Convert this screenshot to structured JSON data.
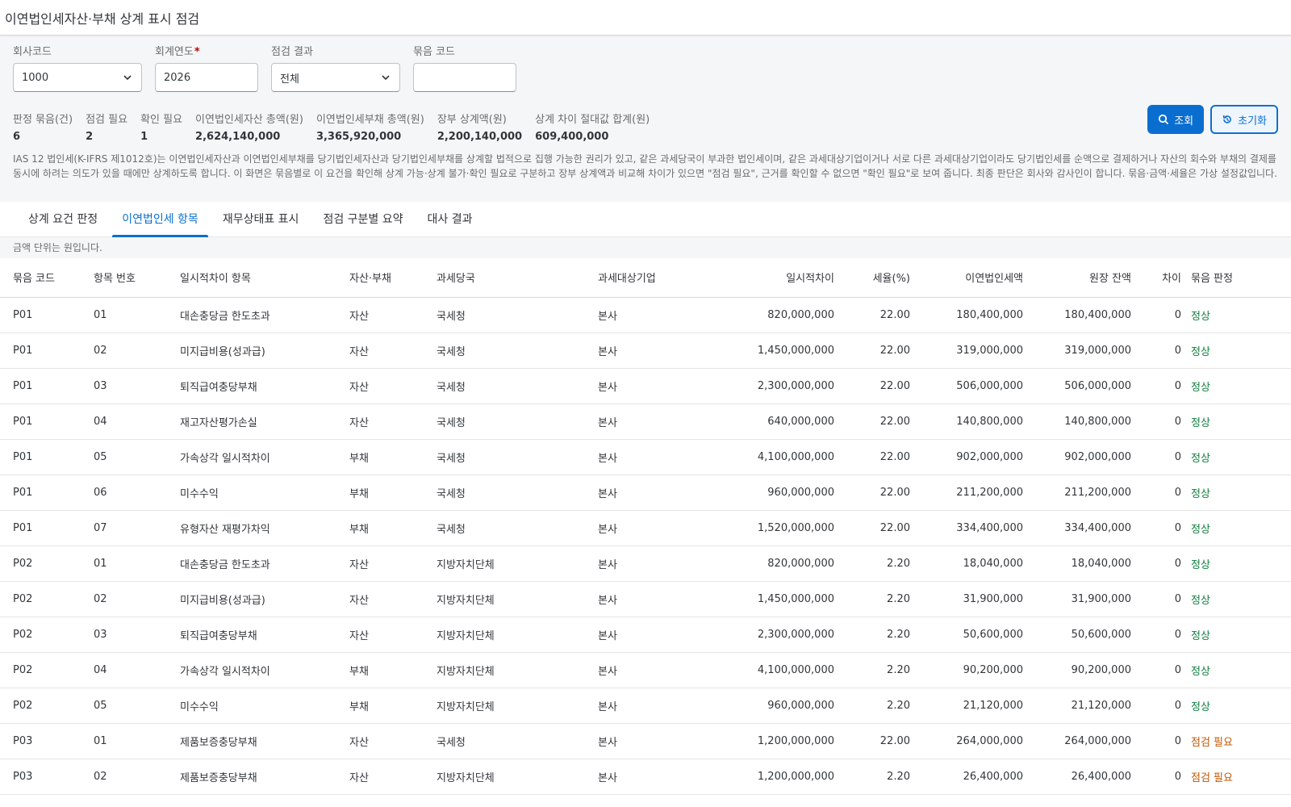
{
  "page": {
    "title": "이연법인세자산·부채 상계 표시 점검"
  },
  "filters": {
    "company": {
      "label": "회사코드",
      "value": "1000"
    },
    "year": {
      "label": "회계연도",
      "required_mark": "*",
      "value": "2026"
    },
    "result": {
      "label": "점검 결과",
      "value": "전체"
    },
    "group": {
      "label": "묶음 코드",
      "value": ""
    }
  },
  "actions": {
    "search_label": "조회",
    "reset_label": "초기화"
  },
  "kpis": [
    {
      "label": "판정 묶음(건)",
      "value": "6"
    },
    {
      "label": "점검 필요",
      "value": "2"
    },
    {
      "label": "확인 필요",
      "value": "1"
    },
    {
      "label": "이연법인세자산 총액(원)",
      "value": "2,624,140,000"
    },
    {
      "label": "이연법인세부채 총액(원)",
      "value": "3,365,920,000"
    },
    {
      "label": "장부 상계액(원)",
      "value": "2,200,140,000"
    },
    {
      "label": "상계 차이 절대값 합계(원)",
      "value": "609,400,000"
    }
  ],
  "note": "IAS 12 법인세(K-IFRS 제1012호)는 이연법인세자산과 이연법인세부채를 당기법인세자산과 당기법인세부채를 상계할 법적으로 집행 가능한 권리가 있고, 같은 과세당국이 부과한 법인세이며, 같은 과세대상기업이거나 서로 다른 과세대상기업이라도 당기법인세를 순액으로 결제하거나 자산의 회수와 부채의 결제를 동시에 하려는 의도가 있을 때에만 상계하도록 합니다. 이 화면은 묶음별로 이 요건을 확인해 상계 가능·상계 불가·확인 필요로 구분하고 장부 상계액과 비교해 차이가 있으면 \"점검 필요\", 근거를 확인할 수 없으면 \"확인 필요\"로 보여 줍니다. 최종 판단은 회사와 감사인이 합니다. 묶음·금액·세율은 가상 설정값입니다.",
  "tabs": [
    {
      "label": "상계 요건 판정",
      "active": false
    },
    {
      "label": "이연법인세 항목",
      "active": true
    },
    {
      "label": "재무상태표 표시",
      "active": false
    },
    {
      "label": "점검 구분별 요약",
      "active": false
    },
    {
      "label": "대사 결과",
      "active": false
    }
  ],
  "unit_note": "금액 단위는 원입니다.",
  "table": {
    "columns": [
      "묶음 코드",
      "항목 번호",
      "일시적차이 항목",
      "자산·부채",
      "과세당국",
      "과세대상기업",
      "일시적차이",
      "세율(%)",
      "이연법인세액",
      "원장 잔액",
      "차이",
      "묶음 판정"
    ],
    "rows": [
      [
        "P01",
        "01",
        "대손충당금 한도초과",
        "자산",
        "국세청",
        "본사",
        "820,000,000",
        "22.00",
        "180,400,000",
        "180,400,000",
        "0",
        "정상"
      ],
      [
        "P01",
        "02",
        "미지급비용(성과급)",
        "자산",
        "국세청",
        "본사",
        "1,450,000,000",
        "22.00",
        "319,000,000",
        "319,000,000",
        "0",
        "정상"
      ],
      [
        "P01",
        "03",
        "퇴직급여충당부채",
        "자산",
        "국세청",
        "본사",
        "2,300,000,000",
        "22.00",
        "506,000,000",
        "506,000,000",
        "0",
        "정상"
      ],
      [
        "P01",
        "04",
        "재고자산평가손실",
        "자산",
        "국세청",
        "본사",
        "640,000,000",
        "22.00",
        "140,800,000",
        "140,800,000",
        "0",
        "정상"
      ],
      [
        "P01",
        "05",
        "가속상각 일시적차이",
        "부채",
        "국세청",
        "본사",
        "4,100,000,000",
        "22.00",
        "902,000,000",
        "902,000,000",
        "0",
        "정상"
      ],
      [
        "P01",
        "06",
        "미수수익",
        "부채",
        "국세청",
        "본사",
        "960,000,000",
        "22.00",
        "211,200,000",
        "211,200,000",
        "0",
        "정상"
      ],
      [
        "P01",
        "07",
        "유형자산 재평가차익",
        "부채",
        "국세청",
        "본사",
        "1,520,000,000",
        "22.00",
        "334,400,000",
        "334,400,000",
        "0",
        "정상"
      ],
      [
        "P02",
        "01",
        "대손충당금 한도초과",
        "자산",
        "지방자치단체",
        "본사",
        "820,000,000",
        "2.20",
        "18,040,000",
        "18,040,000",
        "0",
        "정상"
      ],
      [
        "P02",
        "02",
        "미지급비용(성과급)",
        "자산",
        "지방자치단체",
        "본사",
        "1,450,000,000",
        "2.20",
        "31,900,000",
        "31,900,000",
        "0",
        "정상"
      ],
      [
        "P02",
        "03",
        "퇴직급여충당부채",
        "자산",
        "지방자치단체",
        "본사",
        "2,300,000,000",
        "2.20",
        "50,600,000",
        "50,600,000",
        "0",
        "정상"
      ],
      [
        "P02",
        "04",
        "가속상각 일시적차이",
        "부채",
        "지방자치단체",
        "본사",
        "4,100,000,000",
        "2.20",
        "90,200,000",
        "90,200,000",
        "0",
        "정상"
      ],
      [
        "P02",
        "05",
        "미수수익",
        "부채",
        "지방자치단체",
        "본사",
        "960,000,000",
        "2.20",
        "21,120,000",
        "21,120,000",
        "0",
        "정상"
      ],
      [
        "P03",
        "01",
        "제품보증충당부채",
        "자산",
        "국세청",
        "본사",
        "1,200,000,000",
        "22.00",
        "264,000,000",
        "264,000,000",
        "0",
        "점검 필요"
      ],
      [
        "P03",
        "02",
        "제품보증충당부채",
        "자산",
        "지방자치단체",
        "본사",
        "1,200,000,000",
        "2.20",
        "26,400,000",
        "26,400,000",
        "0",
        "점검 필요"
      ]
    ]
  },
  "colors": {
    "accent": "#0a6ed1",
    "ok": "#107e3e",
    "warn": "#c35500"
  }
}
